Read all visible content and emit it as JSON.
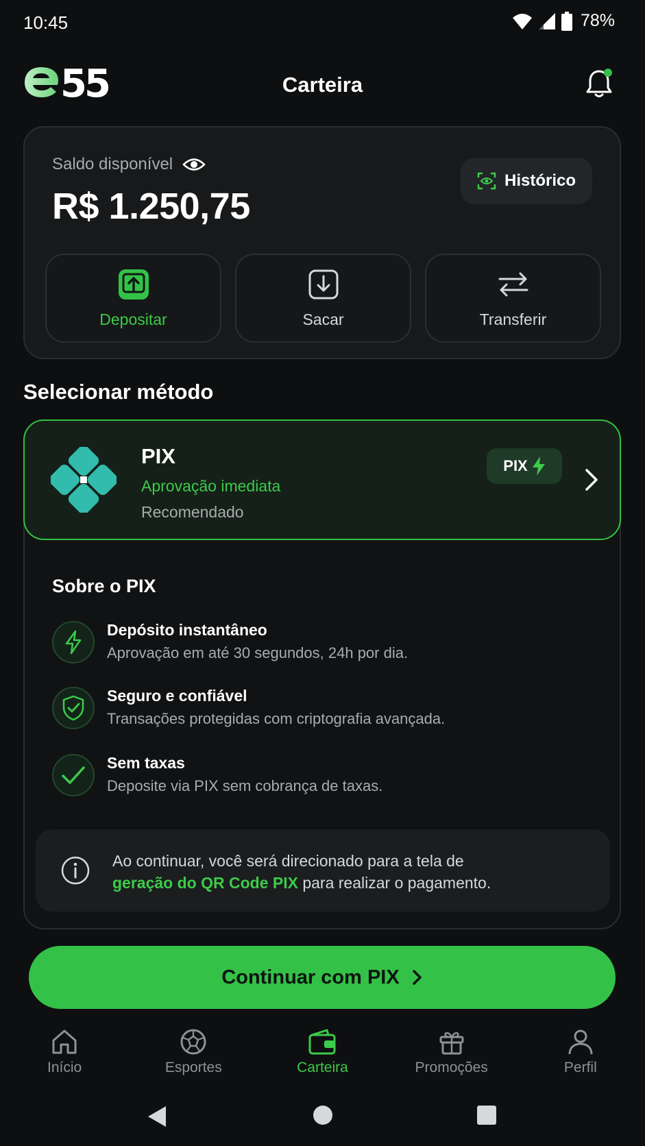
{
  "status_bar": {
    "time": "10:45",
    "battery": "78%"
  },
  "header": {
    "logo_text": "e55",
    "title": "Carteira",
    "notification_dot": true
  },
  "wallet": {
    "balance_label": "Saldo disponível",
    "balance": "R$ 1.250,75",
    "history_label": "Histórico",
    "actions": [
      {
        "label": "Depositar",
        "icon": "deposit-icon",
        "active": true
      },
      {
        "label": "Sacar",
        "icon": "withdraw-icon",
        "active": false
      },
      {
        "label": "Transferir",
        "icon": "transfer-icon",
        "active": false
      }
    ]
  },
  "method_section": {
    "title": "Selecionar método",
    "selected": {
      "name": "PIX",
      "approval": "Aprovação imediata",
      "tag": "Recomendado",
      "badge": "PIX"
    },
    "about_title": "Sobre o PIX",
    "features": [
      {
        "icon": "lightning-icon",
        "title": "Depósito instantâneo",
        "desc": "Aprovação em até 30 segundos, 24h por dia."
      },
      {
        "icon": "shield-check-icon",
        "title": "Seguro e confiável",
        "desc": "Transações protegidas com criptografia avançada."
      },
      {
        "icon": "check-icon",
        "title": "Sem taxas",
        "desc": "Deposite via PIX sem cobrança de taxas."
      }
    ],
    "info": {
      "line1": "Ao continuar, você será direcionado para a tela de",
      "accent": "geração do QR Code PIX",
      "line2_rest": " para realizar o pagamento."
    }
  },
  "cta": {
    "label": "Continuar com PIX"
  },
  "bottom_nav": [
    {
      "label": "Início",
      "icon": "home-icon",
      "active": false
    },
    {
      "label": "Esportes",
      "icon": "soccer-ball-icon",
      "active": false
    },
    {
      "label": "Carteira",
      "icon": "wallet-icon",
      "active": true
    },
    {
      "label": "Promoções",
      "icon": "gift-icon",
      "active": false
    },
    {
      "label": "Perfil",
      "icon": "user-icon",
      "active": false
    }
  ],
  "colors": {
    "accent": "#33c148",
    "background": "#0e0f10",
    "card": "#17191a",
    "pix_teal": "#32bcad"
  }
}
